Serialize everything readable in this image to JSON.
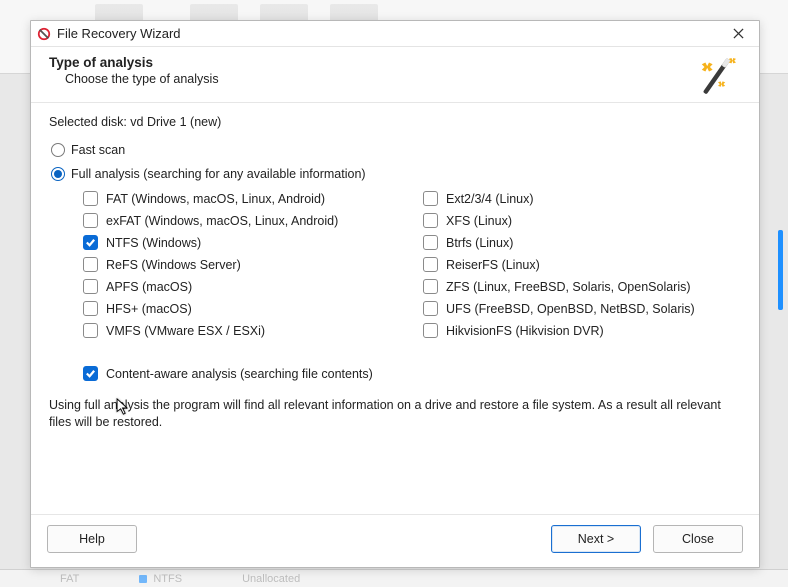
{
  "window": {
    "title": "File Recovery Wizard"
  },
  "header": {
    "heading": "Type of analysis",
    "subheading": "Choose the type of analysis"
  },
  "selected_disk_line": "Selected disk: vd Drive 1 (new)",
  "radios": {
    "fast": {
      "label": "Fast scan",
      "checked": false
    },
    "full": {
      "label": "Full analysis (searching for any available information)",
      "checked": true
    }
  },
  "filesystems_left": [
    {
      "id": "fat",
      "label": "FAT (Windows, macOS, Linux, Android)",
      "checked": false
    },
    {
      "id": "exfat",
      "label": "exFAT (Windows, macOS, Linux, Android)",
      "checked": false
    },
    {
      "id": "ntfs",
      "label": "NTFS (Windows)",
      "checked": true
    },
    {
      "id": "refs",
      "label": "ReFS (Windows Server)",
      "checked": false
    },
    {
      "id": "apfs",
      "label": "APFS (macOS)",
      "checked": false
    },
    {
      "id": "hfs",
      "label": "HFS+ (macOS)",
      "checked": false
    },
    {
      "id": "vmfs",
      "label": "VMFS (VMware ESX / ESXi)",
      "checked": false
    }
  ],
  "filesystems_right": [
    {
      "id": "ext",
      "label": "Ext2/3/4 (Linux)",
      "checked": false
    },
    {
      "id": "xfs",
      "label": "XFS (Linux)",
      "checked": false
    },
    {
      "id": "btrfs",
      "label": "Btrfs (Linux)",
      "checked": false
    },
    {
      "id": "reiser",
      "label": "ReiserFS (Linux)",
      "checked": false
    },
    {
      "id": "zfs",
      "label": "ZFS (Linux, FreeBSD, Solaris, OpenSolaris)",
      "checked": false
    },
    {
      "id": "ufs",
      "label": "UFS (FreeBSD, OpenBSD, NetBSD, Solaris)",
      "checked": false
    },
    {
      "id": "hik",
      "label": "HikvisionFS (Hikvision DVR)",
      "checked": false
    }
  ],
  "content_aware": {
    "label": "Content-aware analysis (searching file contents)",
    "checked": true
  },
  "description": "Using full analysis the program will find all relevant information on a drive and restore a file system. As a result all relevant files will be restored.",
  "buttons": {
    "help": "Help",
    "next": "Next >",
    "close": "Close"
  },
  "bg_status": {
    "a": "FAT",
    "b": "NTFS",
    "c": "Unallocated"
  }
}
